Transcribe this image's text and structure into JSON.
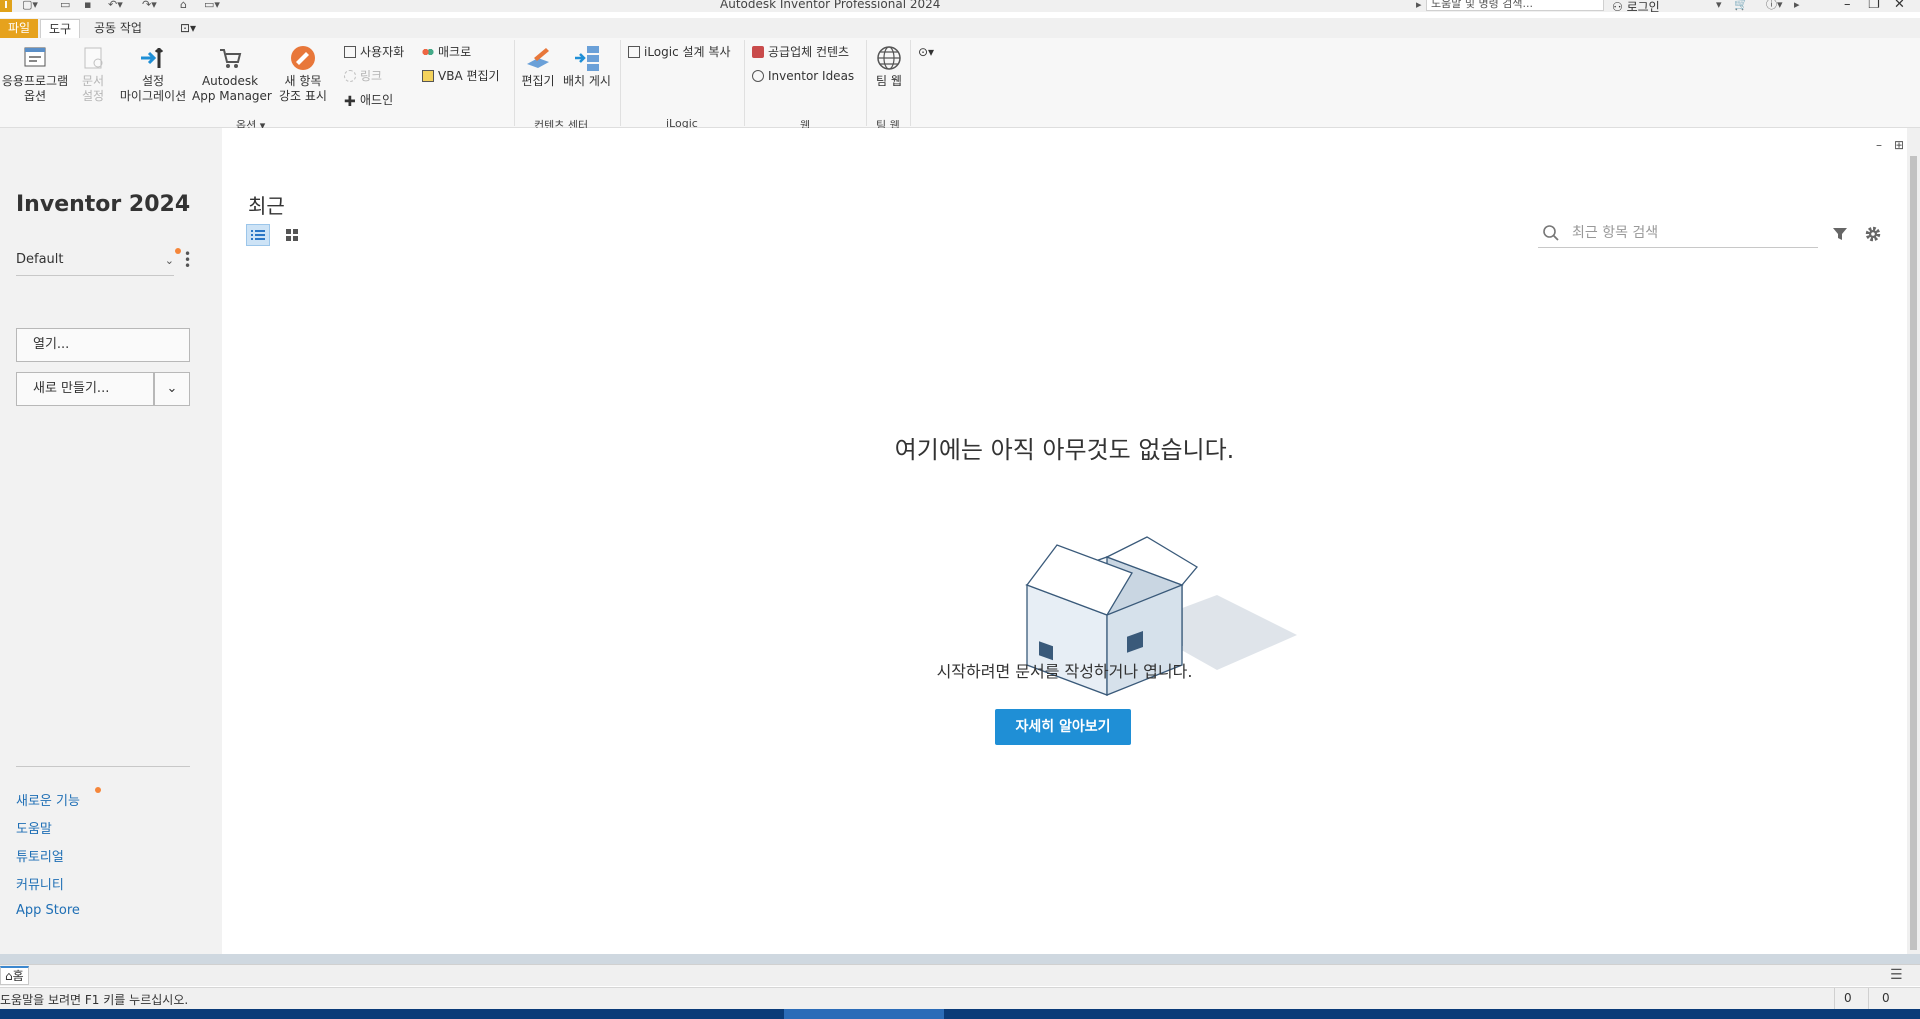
{
  "window": {
    "title": "Autodesk Inventor Professional 2024",
    "app_logo": "I",
    "search_placeholder": "도움말 및 명령 검색...",
    "login": "로그인"
  },
  "menu_tabs": {
    "file": "파일",
    "tools": "도구",
    "collab": "공동 작업"
  },
  "ribbon": {
    "app_options": "응용프로그램\n옵션",
    "doc_settings": "문서\n설정",
    "migrate": "설정\n마이그레이션",
    "app_manager": "Autodesk\nApp Manager",
    "highlight_new": "새 항목\n강조 표시",
    "customize": "사용자화",
    "link": "링크",
    "addin": "애드인",
    "macro": "매크로",
    "vba_editor": "VBA 편집기",
    "options_panel": "옵션",
    "editor": "편집기",
    "publish": "배치 게시",
    "content_center_panel": "컨텐츠 센터",
    "ilogic_copy": "iLogic 설계 복사",
    "ilogic_panel": "iLogic",
    "supplier_content": "공급업체 컨텐츠",
    "inventor_ideas": "Inventor Ideas",
    "web_panel": "웹",
    "team_web": "팀 웹",
    "team_web_panel": "팀 웹"
  },
  "sidebar": {
    "product": "Inventor 2024",
    "project": "Default",
    "open": "열기...",
    "new": "새로 만들기...",
    "links": [
      "새로운 기능",
      "도움말",
      "튜토리얼",
      "커뮤니티",
      "App Store"
    ]
  },
  "main": {
    "heading": "최근",
    "search_placeholder": "최근 항목 검색",
    "empty_title": "여기에는 아직 아무것도 없습니다.",
    "empty_sub": "시작하려면 문서를 작성하거나 엽니다.",
    "learn_more": "자세히 알아보기"
  },
  "doc_tabs": {
    "home": "홈"
  },
  "status": {
    "message": "도움말을 보려면 F1 키를 누르십시오.",
    "count1": "0",
    "count2": "0"
  },
  "colors": {
    "accent": "#1f8fd6",
    "file_tab": "#e6a21d",
    "notify_dot": "#f5863a",
    "link": "#1f6fb5"
  }
}
